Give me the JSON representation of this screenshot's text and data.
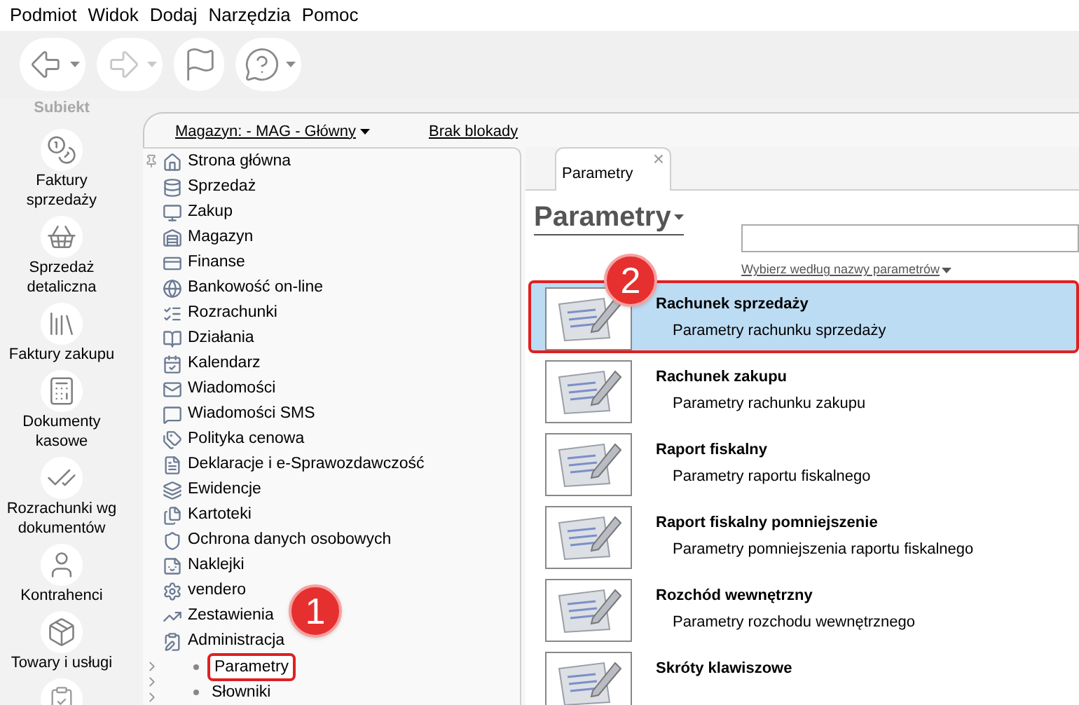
{
  "menu": [
    "Podmiot",
    "Widok",
    "Dodaj",
    "Narzędzia",
    "Pomoc"
  ],
  "toolbar": [
    {
      "kind": "back",
      "has_menu": true,
      "disabled": false
    },
    {
      "kind": "forward",
      "has_menu": true,
      "disabled": true
    },
    {
      "kind": "flag",
      "has_menu": false,
      "disabled": false
    },
    {
      "kind": "help",
      "has_menu": true,
      "disabled": false
    }
  ],
  "logo": {
    "text": "Subiekt"
  },
  "sidebar": {
    "items": [
      "Faktury sprzedaży",
      "Sprzedaż detaliczna",
      "Faktury zakupu",
      "Dokumenty kasowe",
      "Rozrachunki wg dokumentów",
      "Kontrahenci",
      "Towary i usługi"
    ]
  },
  "topbar": {
    "warehouse": "Magazyn: - MAG - Główny",
    "lock": "Brak blokady"
  },
  "tree": {
    "items": [
      {
        "label": "Strona główna"
      },
      {
        "label": "Sprzedaż"
      },
      {
        "label": "Zakup"
      },
      {
        "label": "Magazyn"
      },
      {
        "label": "Finanse"
      },
      {
        "label": "Bankowość on-line"
      },
      {
        "label": "Rozrachunki"
      },
      {
        "label": "Działania"
      },
      {
        "label": "Kalendarz"
      },
      {
        "label": "Wiadomości"
      },
      {
        "label": "Wiadomości SMS"
      },
      {
        "label": "Polityka cenowa"
      },
      {
        "label": "Deklaracje i e-Sprawozdawczość"
      },
      {
        "label": "Ewidencje"
      },
      {
        "label": "Kartoteki"
      },
      {
        "label": "Ochrona danych osobowych"
      },
      {
        "label": "Naklejki"
      },
      {
        "label": "vendero"
      },
      {
        "label": "Zestawienia"
      },
      {
        "label": "Administracja",
        "expanded": true,
        "children": [
          {
            "label": "Parametry",
            "selected": true
          },
          {
            "label": "Słowniki",
            "selected": false
          }
        ]
      }
    ]
  },
  "tab": {
    "label": "Parametry",
    "close": "×"
  },
  "heading": "Parametry",
  "filter": "Wybierz według nazwy parametrów",
  "params": [
    {
      "title": "Rachunek sprzedaży",
      "description": "Parametry rachunku sprzedaży",
      "selected": true
    },
    {
      "title": "Rachunek zakupu",
      "description": "Parametry rachunku zakupu",
      "selected": false
    },
    {
      "title": "Raport fiskalny",
      "description": "Parametry raportu fiskalnego",
      "selected": false
    },
    {
      "title": "Raport fiskalny pomniejszenie",
      "description": "Parametry pomniejszenia raportu fiskalnego",
      "selected": false
    },
    {
      "title": "Rozchód wewnętrzny",
      "description": "Parametry rozchodu wewnętrznego",
      "selected": false
    },
    {
      "title": "Skróty klawiszowe",
      "selected": false
    }
  ],
  "markers": [
    "1",
    "2"
  ]
}
